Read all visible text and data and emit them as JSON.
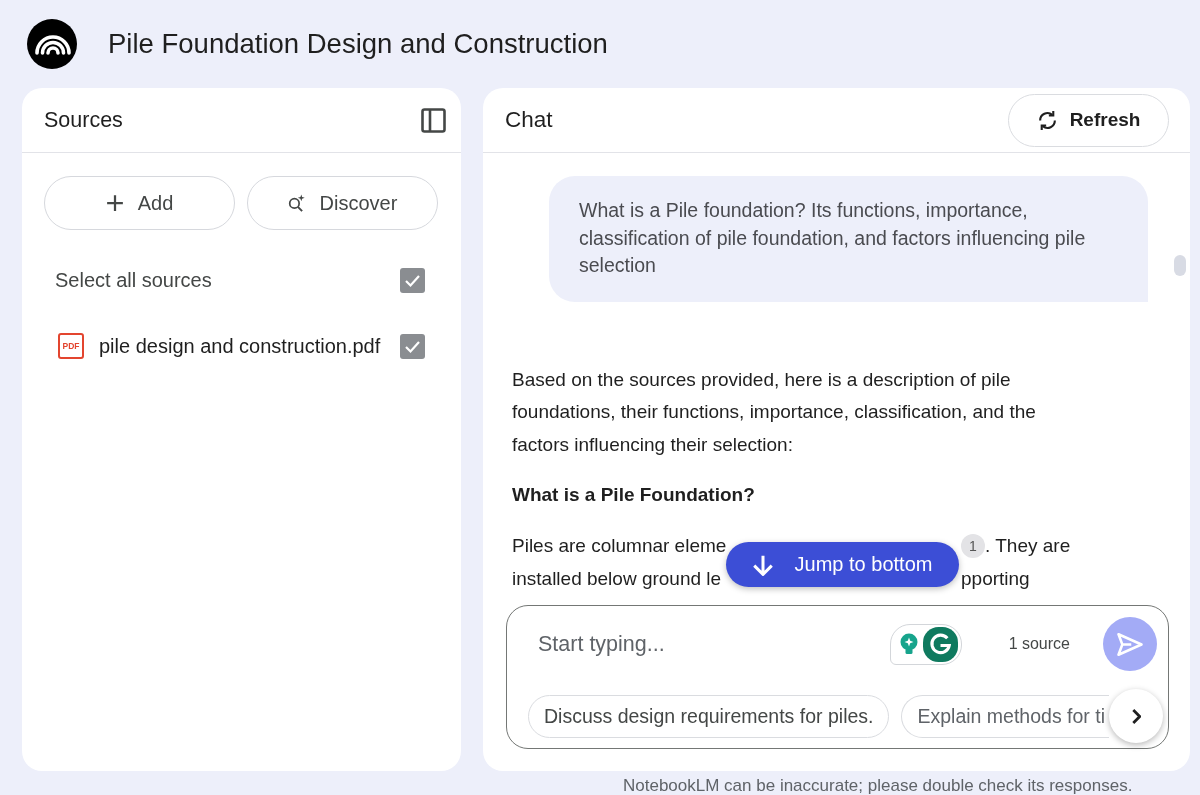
{
  "header": {
    "title": "Pile Foundation Design and Construction"
  },
  "sources_panel": {
    "title": "Sources",
    "actions": [
      {
        "kind": "add",
        "label": "Add"
      },
      {
        "kind": "discover",
        "label": "Discover"
      }
    ],
    "select_all": {
      "label": "Select all sources",
      "checked": true
    },
    "sources": [
      {
        "name": "pile design and construction.pdf",
        "file_type": "PDF",
        "checked": true
      }
    ]
  },
  "chat_panel": {
    "title": "Chat",
    "refresh_button": {
      "label": "Refresh"
    },
    "question": {
      "text": "What is a Pile foundation? Its functions, importance, classification of pile foundation, and factors influencing pile selection"
    },
    "answer": {
      "blocks": [
        {
          "kind": "paragraph",
          "text": "Based on the sources provided, here is a description of pile foundations, their functions, importance, classification, and the factors influencing their selection:"
        },
        {
          "kind": "heading",
          "text": "What is a Pile Foundation?"
        },
        {
          "kind": "covered",
          "lines": [
            {
              "start": "Piles are columnar eleme",
              "citation": "1",
              "end": ". They are"
            },
            {
              "start": "installed below ground le",
              "end": "pporting"
            }
          ]
        }
      ]
    },
    "jump_button": {
      "label": "Jump to bottom"
    },
    "composer": {
      "placeholder": "Start typing...",
      "source_count": "1 source",
      "send_button": {
        "disabled": true
      },
      "suggestions": [
        "Discuss design requirements for piles.",
        "Explain methods for ti"
      ]
    }
  },
  "footer": {
    "disclaimer": "NotebookLM can be inaccurate; please double check its responses."
  }
}
